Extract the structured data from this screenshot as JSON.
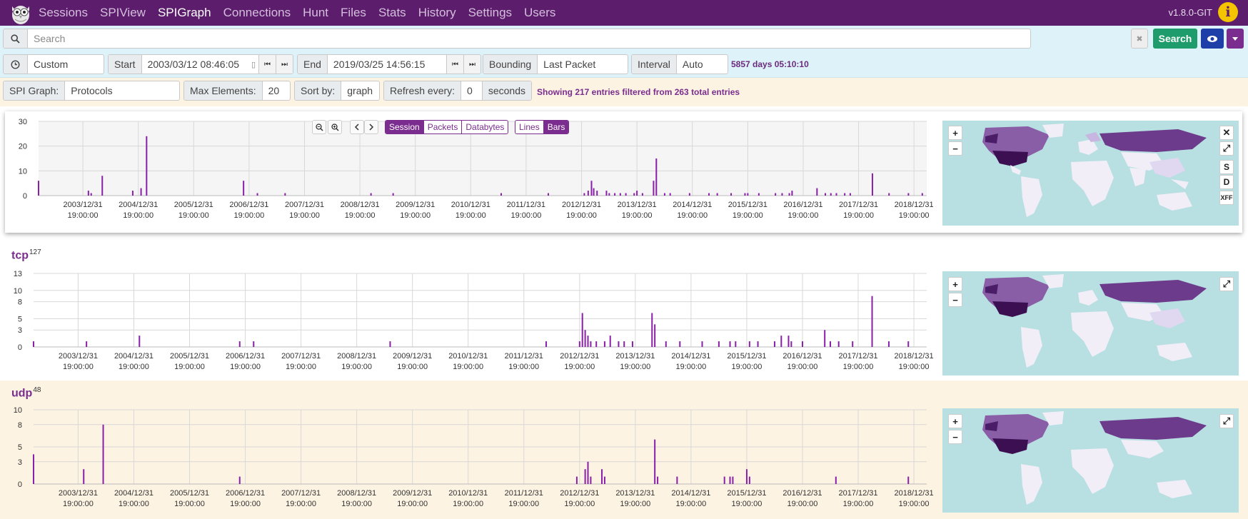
{
  "nav": {
    "items": [
      "Sessions",
      "SPIView",
      "SPIGraph",
      "Connections",
      "Hunt",
      "Files",
      "Stats",
      "History",
      "Settings",
      "Users"
    ],
    "active": "SPIGraph",
    "version": "v1.8.0-GIT",
    "info_label": "i"
  },
  "search": {
    "placeholder": "Search",
    "clear_label": "✖",
    "button_label": "Search"
  },
  "time": {
    "range_value": "Custom",
    "start_label": "Start",
    "start_value": "2003/03/12 08:46:05",
    "end_label": "End",
    "end_value": "2019/03/25 14:56:15",
    "bounding_label": "Bounding",
    "bounding_value": "Last Packet",
    "interval_label": "Interval",
    "interval_value": "Auto",
    "duration": "5857 days 05:10:10"
  },
  "spi": {
    "graph_label": "SPI Graph:",
    "graph_value": "Protocols",
    "max_label": "Max Elements:",
    "max_value": "20",
    "sort_label": "Sort by:",
    "sort_value": "graph",
    "refresh_label": "Refresh every:",
    "refresh_value": "0",
    "refresh_unit": "seconds",
    "status": "Showing 217 entries filtered from 263 total entries"
  },
  "toolbar": {
    "modes": [
      "Session",
      "Packets",
      "Databytes"
    ],
    "active_mode": "Session",
    "styles": [
      "Lines",
      "Bars"
    ],
    "active_style": "Bars"
  },
  "map_buttons": [
    "S",
    "D",
    "XFF"
  ],
  "colors": {
    "accent": "#7b2d8f",
    "nav": "#5b1d6c",
    "search_green": "#1e9c6b"
  },
  "x_tick_labels": [
    "2003/12/31",
    "2004/12/31",
    "2005/12/31",
    "2006/12/31",
    "2007/12/31",
    "2008/12/31",
    "2009/12/31",
    "2010/12/31",
    "2011/12/31",
    "2012/12/31",
    "2013/12/31",
    "2014/12/31",
    "2015/12/31",
    "2016/12/31",
    "2017/12/31",
    "2018/12/31"
  ],
  "x_tick_time": "19:00:00",
  "chart_data": [
    {
      "type": "bar",
      "title": "",
      "y_ticks": [
        0,
        10,
        20,
        30
      ],
      "ylim": [
        0,
        30
      ],
      "x_range": [
        2003.2,
        2019.23
      ],
      "x": [
        2003.2,
        2004.1,
        2004.15,
        2004.35,
        2004.9,
        2005.05,
        2005.15,
        2006.9,
        2007.15,
        2007.65,
        2009.2,
        2009.6,
        2011.55,
        2012.4,
        2013.05,
        2013.12,
        2013.18,
        2013.22,
        2013.28,
        2013.45,
        2013.5,
        2013.6,
        2013.7,
        2013.8,
        2013.95,
        2014.0,
        2014.1,
        2014.3,
        2014.35,
        2014.5,
        2014.6,
        2014.95,
        2015.3,
        2015.45,
        2015.7,
        2015.95,
        2016.0,
        2016.2,
        2016.5,
        2016.62,
        2016.75,
        2016.8,
        2017.25,
        2017.4,
        2017.5,
        2017.6,
        2017.75,
        2017.85,
        2018.25,
        2018.55,
        2018.9,
        2019.15
      ],
      "values": [
        6,
        2,
        1,
        8,
        2,
        3,
        24,
        6,
        1,
        1,
        1,
        1,
        1,
        1,
        1,
        2,
        6,
        3,
        2,
        2,
        1,
        1,
        1,
        1,
        1,
        2,
        1,
        6,
        15,
        1,
        1,
        1,
        1,
        1,
        1,
        1,
        1,
        1,
        1,
        1,
        1,
        2,
        3,
        1,
        1,
        1,
        1,
        1,
        9,
        1,
        1,
        1
      ]
    },
    {
      "type": "bar",
      "title": "tcp",
      "count": "127",
      "y_ticks": [
        0,
        3,
        5,
        8,
        10,
        13
      ],
      "ylim": [
        0,
        13
      ],
      "x_range": [
        2003.2,
        2019.23
      ],
      "x": [
        2003.2,
        2004.15,
        2005.1,
        2006.9,
        2007.15,
        2009.6,
        2012.4,
        2013.0,
        2013.05,
        2013.1,
        2013.15,
        2013.2,
        2013.3,
        2013.45,
        2013.55,
        2013.7,
        2013.8,
        2013.95,
        2014.3,
        2014.35,
        2014.55,
        2014.8,
        2015.2,
        2015.5,
        2015.7,
        2015.8,
        2016.05,
        2016.2,
        2016.5,
        2016.62,
        2016.75,
        2016.8,
        2017.0,
        2017.4,
        2017.5,
        2017.65,
        2017.9,
        2018.25,
        2018.55,
        2018.9
      ],
      "values": [
        1,
        1,
        2,
        1,
        1,
        1,
        1,
        1,
        6,
        3,
        2,
        1,
        1,
        1,
        2,
        1,
        1,
        1,
        6,
        4,
        1,
        1,
        1,
        1,
        1,
        1,
        1,
        1,
        1,
        2,
        2,
        1,
        1,
        3,
        1,
        1,
        1,
        9,
        1,
        1
      ]
    },
    {
      "type": "bar",
      "title": "udp",
      "count": "48",
      "y_ticks": [
        0,
        3,
        5,
        8,
        10
      ],
      "ylim": [
        0,
        10
      ],
      "x_range": [
        2003.2,
        2019.23
      ],
      "x": [
        2003.2,
        2004.1,
        2004.45,
        2006.9,
        2012.95,
        2013.1,
        2013.15,
        2013.2,
        2013.4,
        2013.45,
        2014.35,
        2014.4,
        2014.75,
        2015.6,
        2015.7,
        2015.75,
        2016.0,
        2016.05,
        2017.6,
        2018.9
      ],
      "values": [
        4,
        2,
        8,
        1,
        1,
        2,
        3,
        1,
        2,
        1,
        6,
        1,
        1,
        1,
        1,
        1,
        2,
        1,
        1,
        1
      ]
    }
  ]
}
